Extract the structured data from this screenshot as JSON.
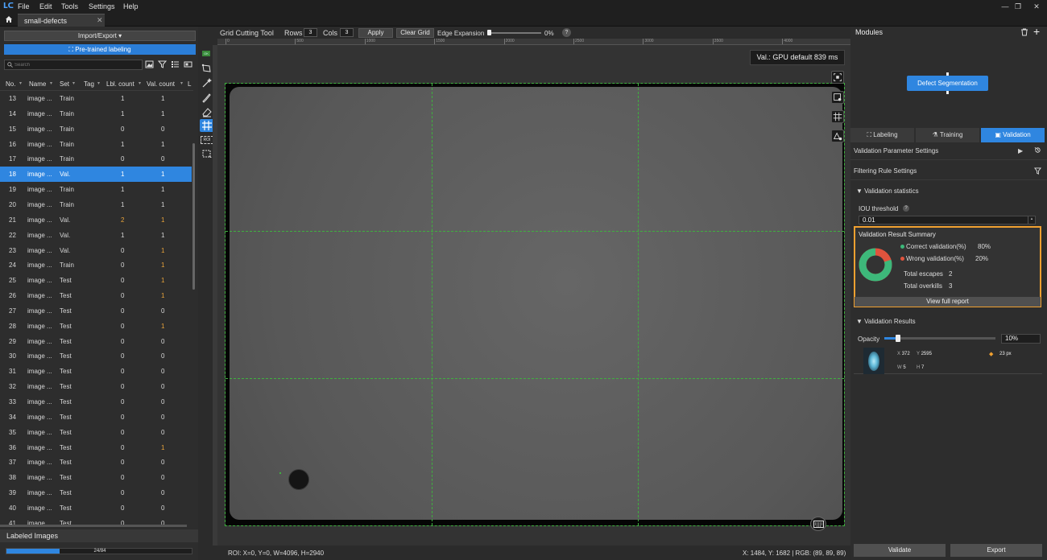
{
  "menu": [
    "File",
    "Edit",
    "Tools",
    "Settings",
    "Help"
  ],
  "file_tab": {
    "label": "small-defects",
    "close": "✕"
  },
  "left_panel": {
    "import_export_label": "Import/Export ▾",
    "pretrained_label": "Pre-trained labeling",
    "search_placeholder": "Search",
    "columns": [
      "No.",
      "Name",
      "Set",
      "Tag",
      "Lbl. count",
      "Val. count",
      "L"
    ],
    "rows": [
      {
        "no": "13",
        "name": "image ...",
        "set": "Train",
        "lbl": "1",
        "val": "1",
        "warn": false,
        "selected": false
      },
      {
        "no": "14",
        "name": "image ...",
        "set": "Train",
        "lbl": "1",
        "val": "1",
        "warn": false,
        "selected": false
      },
      {
        "no": "15",
        "name": "image ...",
        "set": "Train",
        "lbl": "0",
        "val": "0",
        "warn": false,
        "selected": false
      },
      {
        "no": "16",
        "name": "image ...",
        "set": "Train",
        "lbl": "1",
        "val": "1",
        "warn": false,
        "selected": false
      },
      {
        "no": "17",
        "name": "image ...",
        "set": "Train",
        "lbl": "0",
        "val": "0",
        "warn": false,
        "selected": false
      },
      {
        "no": "18",
        "name": "image ...",
        "set": "Val.",
        "lbl": "1",
        "val": "1",
        "warn": false,
        "selected": true
      },
      {
        "no": "19",
        "name": "image ...",
        "set": "Train",
        "lbl": "1",
        "val": "1",
        "warn": false,
        "selected": false
      },
      {
        "no": "20",
        "name": "image ...",
        "set": "Train",
        "lbl": "1",
        "val": "1",
        "warn": false,
        "selected": false
      },
      {
        "no": "21",
        "name": "image ...",
        "set": "Val.",
        "lbl": "2",
        "val": "1",
        "warn": true,
        "selected": false
      },
      {
        "no": "22",
        "name": "image ...",
        "set": "Val.",
        "lbl": "1",
        "val": "1",
        "warn": false,
        "selected": false
      },
      {
        "no": "23",
        "name": "image ...",
        "set": "Val.",
        "lbl": "0",
        "val": "1",
        "warn": true,
        "selected": false
      },
      {
        "no": "24",
        "name": "image ...",
        "set": "Train",
        "lbl": "0",
        "val": "1",
        "warn": true,
        "selected": false
      },
      {
        "no": "25",
        "name": "image ...",
        "set": "Test",
        "lbl": "0",
        "val": "1",
        "warn": true,
        "selected": false
      },
      {
        "no": "26",
        "name": "image ...",
        "set": "Test",
        "lbl": "0",
        "val": "1",
        "warn": true,
        "selected": false
      },
      {
        "no": "27",
        "name": "image ...",
        "set": "Test",
        "lbl": "0",
        "val": "0",
        "warn": false,
        "selected": false
      },
      {
        "no": "28",
        "name": "image ...",
        "set": "Test",
        "lbl": "0",
        "val": "1",
        "warn": true,
        "selected": false
      },
      {
        "no": "29",
        "name": "image ...",
        "set": "Test",
        "lbl": "0",
        "val": "0",
        "warn": false,
        "selected": false
      },
      {
        "no": "30",
        "name": "image ...",
        "set": "Test",
        "lbl": "0",
        "val": "0",
        "warn": false,
        "selected": false
      },
      {
        "no": "31",
        "name": "image ...",
        "set": "Test",
        "lbl": "0",
        "val": "0",
        "warn": false,
        "selected": false
      },
      {
        "no": "32",
        "name": "image ...",
        "set": "Test",
        "lbl": "0",
        "val": "0",
        "warn": false,
        "selected": false
      },
      {
        "no": "33",
        "name": "image ...",
        "set": "Test",
        "lbl": "0",
        "val": "0",
        "warn": false,
        "selected": false
      },
      {
        "no": "34",
        "name": "image ...",
        "set": "Test",
        "lbl": "0",
        "val": "0",
        "warn": false,
        "selected": false
      },
      {
        "no": "35",
        "name": "image ...",
        "set": "Test",
        "lbl": "0",
        "val": "0",
        "warn": false,
        "selected": false
      },
      {
        "no": "36",
        "name": "image ...",
        "set": "Test",
        "lbl": "0",
        "val": "1",
        "warn": true,
        "selected": false
      },
      {
        "no": "37",
        "name": "image ...",
        "set": "Test",
        "lbl": "0",
        "val": "0",
        "warn": false,
        "selected": false
      },
      {
        "no": "38",
        "name": "image ...",
        "set": "Test",
        "lbl": "0",
        "val": "0",
        "warn": false,
        "selected": false
      },
      {
        "no": "39",
        "name": "image ...",
        "set": "Test",
        "lbl": "0",
        "val": "0",
        "warn": false,
        "selected": false
      },
      {
        "no": "40",
        "name": "image ...",
        "set": "Test",
        "lbl": "0",
        "val": "0",
        "warn": false,
        "selected": false
      },
      {
        "no": "41",
        "name": "image ...",
        "set": "Test",
        "lbl": "0",
        "val": "0",
        "warn": false,
        "selected": false
      }
    ],
    "labeled_images_label": "Labeled Images",
    "labeled_progress": {
      "text": "24/84",
      "done": 24,
      "total": 84
    }
  },
  "canvas_toolbar": {
    "tool_label": "Grid Cutting Tool",
    "rows_label": "Rows",
    "rows_value": "3",
    "cols_label": "Cols",
    "cols_value": "3",
    "apply_label": "Apply",
    "clear_label": "Clear Grid",
    "edge_label": "Edge Expansion",
    "edge_value": "0%",
    "edge_fraction": 0,
    "help": "?"
  },
  "ruler": [
    "0",
    "500",
    "1000",
    "1500",
    "2000",
    "2500",
    "3000",
    "3500",
    "4000"
  ],
  "canvas": {
    "val_badge": "Val.:  GPU default 839 ms",
    "grid": {
      "rows": 3,
      "cols": 3
    },
    "accent": "#3fb03f",
    "status_left": "ROI: X=0, Y=0, W=4096, H=2940",
    "status_right": "X: 1484, Y: 1682 | RGB: (89, 89, 89)"
  },
  "right_panel": {
    "modules_title": "Modules",
    "module_node": "Defect Segmentation",
    "tabs": [
      {
        "label": "Labeling",
        "icon": "labeling-icon",
        "active": false
      },
      {
        "label": "Training",
        "icon": "training-icon",
        "active": false
      },
      {
        "label": "Validation",
        "icon": "validation-icon",
        "active": true
      }
    ],
    "val_param_settings": "Validation Parameter Settings",
    "filtering_rule_settings": "Filtering Rule Settings",
    "val_statistics": "Validation statistics",
    "iou_label": "IOU threshold",
    "iou_value": "0.01",
    "summary": {
      "title": "Validation Result Summary",
      "correct_label": "Correct validation(%)",
      "correct_value": "80%",
      "correct_pct": 80,
      "correct_color": "#3db87a",
      "wrong_label": "Wrong validation(%)",
      "wrong_value": "20%",
      "wrong_pct": 20,
      "wrong_color": "#e0533d",
      "escapes_label": "Total escapes",
      "escapes_value": "2",
      "overkills_label": "Total overkills",
      "overkills_value": "3",
      "report_label": "View full report",
      "highlight_color": "#f0a030"
    },
    "val_results_header": "Validation Results",
    "opacity_label": "Opacity",
    "opacity_value": "10%",
    "opacity_fraction": 0.1,
    "result": {
      "x_label": "X",
      "x": "372",
      "y_label": "Y",
      "y": "2595",
      "w_label": "W",
      "w": "5",
      "h_label": "H",
      "h": "7",
      "area": "23 px"
    },
    "validate_label": "Validate",
    "export_label": "Export"
  }
}
